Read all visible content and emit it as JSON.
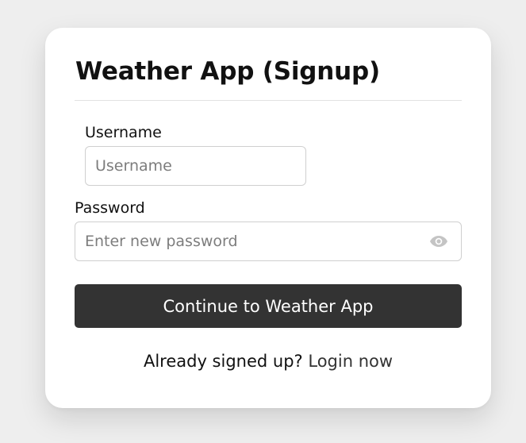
{
  "form": {
    "title": "Weather App (Signup)",
    "username": {
      "label": "Username",
      "placeholder": "Username",
      "value": ""
    },
    "password": {
      "label": "Password",
      "placeholder": "Enter new password",
      "value": "",
      "toggle_icon": "eye-icon"
    },
    "submit_label": "Continue to Weather App",
    "footer": {
      "prompt": "Already signed up?",
      "link_label": "Login now"
    }
  },
  "colors": {
    "page_background": "#eeeeee",
    "card_background": "#ffffff",
    "button_background": "#333333",
    "button_text": "#ffffff",
    "border": "#cfcfcf",
    "placeholder": "#7d7d7d",
    "icon": "#c4c4c4"
  }
}
